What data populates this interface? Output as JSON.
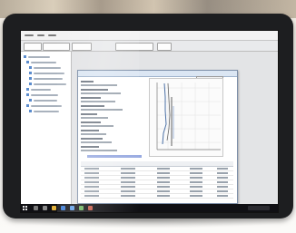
{
  "photo": {
    "subject": "",
    "colors": {
      "tablet_frame": "#1d1e20",
      "screen_bg": "#e3e4e6",
      "taskbar": "#101014",
      "accent_blue": "#5b8ccd",
      "plot_line": "#4a6fa5"
    }
  },
  "app": {
    "menubar": {
      "items": []
    },
    "toolbar": {
      "buttons": []
    },
    "sidebar": {
      "items": []
    },
    "window": {
      "title": "",
      "save_label": "",
      "form_fields": [],
      "table": {
        "headers": [],
        "rows": []
      }
    }
  },
  "taskbar": {
    "icons": [
      "windows-start-icon",
      "search-icon",
      "task-view-icon",
      "file-explorer-icon",
      "browser-icon",
      "app-icon",
      "app-icon",
      "app-icon"
    ]
  }
}
